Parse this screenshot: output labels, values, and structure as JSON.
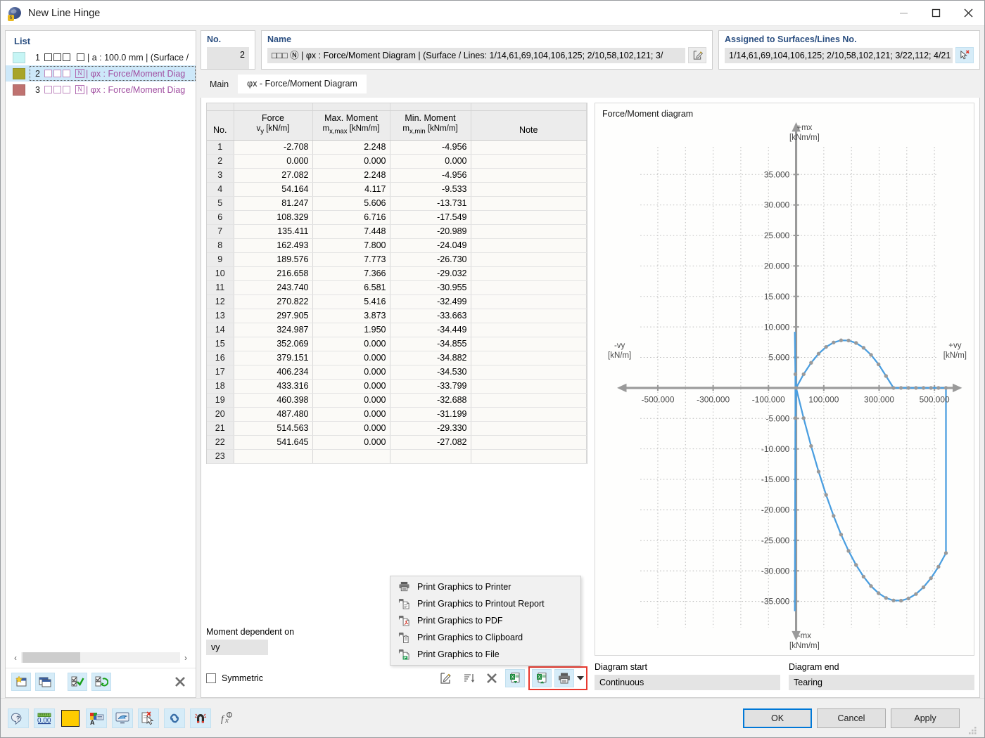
{
  "window": {
    "title": "New Line Hinge",
    "icon": "line-hinge-icon",
    "minimize": "minimize-icon",
    "maximize": "maximize-icon",
    "close": "close-icon"
  },
  "list": {
    "header": "List",
    "items": [
      {
        "num": "1",
        "color": "#c6f5f5",
        "badge": "",
        "text": "| a : 100.0 mm | (Surface /",
        "selected": false,
        "purple": false
      },
      {
        "num": "2",
        "color": "#a8a428",
        "badge": "N",
        "text": "| φx : Force/Moment Diag",
        "selected": true,
        "purple": true
      },
      {
        "num": "3",
        "color": "#bf7270",
        "badge": "N",
        "text": "| φx : Force/Moment Diag",
        "selected": false,
        "purple": true
      }
    ],
    "toolbar": [
      {
        "name": "new-item-button",
        "glyph": "new-window-icon"
      },
      {
        "name": "copy-item-button",
        "glyph": "copy-window-icon"
      },
      {
        "name": "select-all-button",
        "glyph": "check-all-icon"
      },
      {
        "name": "invert-selection-button",
        "glyph": "invert-check-icon"
      },
      {
        "name": "delete-item-button",
        "glyph": "x-icon"
      }
    ]
  },
  "fields": {
    "no_label": "No.",
    "no_value": "2",
    "name_label": "Name",
    "name_value": "□□□  Ⓝ | φx : Force/Moment Diagram | (Surface / Lines: 1/14,61,69,104,106,125; 2/10,58,102,121; 3/",
    "name_edit_button": "edit-name-button",
    "assigned_label": "Assigned to Surfaces/Lines No.",
    "assigned_value": "1/14,61,69,104,106,125; 2/10,58,102,121; 3/22,112; 4/21",
    "assigned_pick_button": "pick-objects-button"
  },
  "tabs": [
    {
      "label": "Main",
      "name": "tab-main",
      "active": false
    },
    {
      "label": "φx - Force/Moment Diagram",
      "name": "tab-force-moment-diagram",
      "active": true
    }
  ],
  "table": {
    "columns": [
      {
        "line1": "",
        "line2": "No."
      },
      {
        "line1": "Force",
        "line2": "vy [kN/m]"
      },
      {
        "line1": "Max. Moment",
        "line2": "mx,max [kNm/m]"
      },
      {
        "line1": "Min. Moment",
        "line2": "mx,min [kNm/m]"
      },
      {
        "line1": "",
        "line2": "Note"
      }
    ],
    "rows": [
      {
        "no": "1",
        "force": "-2.708",
        "mmax": "2.248",
        "mmin": "-4.956",
        "note": ""
      },
      {
        "no": "2",
        "force": "0.000",
        "mmax": "0.000",
        "mmin": "0.000",
        "note": ""
      },
      {
        "no": "3",
        "force": "27.082",
        "mmax": "2.248",
        "mmin": "-4.956",
        "note": ""
      },
      {
        "no": "4",
        "force": "54.164",
        "mmax": "4.117",
        "mmin": "-9.533",
        "note": ""
      },
      {
        "no": "5",
        "force": "81.247",
        "mmax": "5.606",
        "mmin": "-13.731",
        "note": ""
      },
      {
        "no": "6",
        "force": "108.329",
        "mmax": "6.716",
        "mmin": "-17.549",
        "note": ""
      },
      {
        "no": "7",
        "force": "135.411",
        "mmax": "7.448",
        "mmin": "-20.989",
        "note": ""
      },
      {
        "no": "8",
        "force": "162.493",
        "mmax": "7.800",
        "mmin": "-24.049",
        "note": ""
      },
      {
        "no": "9",
        "force": "189.576",
        "mmax": "7.773",
        "mmin": "-26.730",
        "note": ""
      },
      {
        "no": "10",
        "force": "216.658",
        "mmax": "7.366",
        "mmin": "-29.032",
        "note": ""
      },
      {
        "no": "11",
        "force": "243.740",
        "mmax": "6.581",
        "mmin": "-30.955",
        "note": ""
      },
      {
        "no": "12",
        "force": "270.822",
        "mmax": "5.416",
        "mmin": "-32.499",
        "note": ""
      },
      {
        "no": "13",
        "force": "297.905",
        "mmax": "3.873",
        "mmin": "-33.663",
        "note": ""
      },
      {
        "no": "14",
        "force": "324.987",
        "mmax": "1.950",
        "mmin": "-34.449",
        "note": ""
      },
      {
        "no": "15",
        "force": "352.069",
        "mmax": "0.000",
        "mmin": "-34.855",
        "note": ""
      },
      {
        "no": "16",
        "force": "379.151",
        "mmax": "0.000",
        "mmin": "-34.882",
        "note": ""
      },
      {
        "no": "17",
        "force": "406.234",
        "mmax": "0.000",
        "mmin": "-34.530",
        "note": ""
      },
      {
        "no": "18",
        "force": "433.316",
        "mmax": "0.000",
        "mmin": "-33.799",
        "note": ""
      },
      {
        "no": "19",
        "force": "460.398",
        "mmax": "0.000",
        "mmin": "-32.688",
        "note": ""
      },
      {
        "no": "20",
        "force": "487.480",
        "mmax": "0.000",
        "mmin": "-31.199",
        "note": ""
      },
      {
        "no": "21",
        "force": "514.563",
        "mmax": "0.000",
        "mmin": "-29.330",
        "note": ""
      },
      {
        "no": "22",
        "force": "541.645",
        "mmax": "0.000",
        "mmin": "-27.082",
        "note": ""
      },
      {
        "no": "23",
        "force": "",
        "mmax": "",
        "mmin": "",
        "note": ""
      }
    ]
  },
  "moment_dependent": {
    "label": "Moment dependent on",
    "value": "vy",
    "symmetric_label": "Symmetric",
    "symmetric_checked": false
  },
  "table_toolbar": [
    {
      "name": "edit-table-button",
      "glyph": "edit-icon"
    },
    {
      "name": "sort-table-button",
      "glyph": "sort-icon"
    },
    {
      "name": "clear-table-button",
      "glyph": "x-icon"
    },
    {
      "name": "import-excel-button",
      "glyph": "excel-import-icon"
    },
    {
      "name": "export-excel-button",
      "glyph": "excel-export-icon"
    },
    {
      "name": "print-graphics-button",
      "glyph": "printer-icon"
    },
    {
      "name": "print-dropdown-arrow",
      "glyph": "chevron-down-icon"
    }
  ],
  "context_menu": {
    "items": [
      {
        "label": "Print Graphics to Printer",
        "icon": "printer-icon"
      },
      {
        "label": "Print Graphics to Printout Report",
        "icon": "print-report-icon"
      },
      {
        "label": "Print Graphics to PDF",
        "icon": "print-pdf-icon"
      },
      {
        "label": "Print Graphics to Clipboard",
        "icon": "print-clipboard-icon"
      },
      {
        "label": "Print Graphics to File",
        "icon": "print-file-icon"
      }
    ]
  },
  "diagram": {
    "start_label": "Diagram start",
    "start_value": "Continuous",
    "end_label": "Diagram end",
    "end_value": "Tearing"
  },
  "chart_data": {
    "type": "line",
    "title": "Force/Moment diagram",
    "xlabel_pos": "+vy",
    "xlabel_pos_unit": "[kN/m]",
    "xlabel_neg": "-vy",
    "xlabel_neg_unit": "[kN/m]",
    "ylabel_pos": "+mx",
    "ylabel_pos_unit": "[kNm/m]",
    "ylabel_neg": "-mx",
    "ylabel_neg_unit": "[kNm/m]",
    "xticks": [
      "-500.000",
      "-300.000",
      "-100.000",
      "100.000",
      "300.000",
      "500.000"
    ],
    "xtick_values": [
      -500,
      -300,
      -100,
      100,
      300,
      500
    ],
    "yticks": [
      "35.000",
      "30.000",
      "25.000",
      "20.000",
      "15.000",
      "10.000",
      "5.000",
      "-5.000",
      "-10.000",
      "-15.000",
      "-20.000",
      "-25.000",
      "-30.000",
      "-35.000"
    ],
    "ytick_values": [
      35,
      30,
      25,
      20,
      15,
      10,
      5,
      -5,
      -10,
      -15,
      -20,
      -25,
      -30,
      -35
    ],
    "xlim": [
      -620,
      620
    ],
    "ylim": [
      -38,
      38
    ],
    "grid": true,
    "line_color": "#4a9ee0",
    "marker_color": "#9a9a9a",
    "series": [
      {
        "name": "mx,max",
        "x": [
          -2.708,
          0.0,
          27.082,
          54.164,
          81.247,
          108.329,
          135.411,
          162.493,
          189.576,
          216.658,
          243.74,
          270.822,
          297.905,
          324.987,
          352.069,
          379.151,
          406.234,
          433.316,
          460.398,
          487.48,
          514.563,
          541.645
        ],
        "y": [
          2.248,
          0.0,
          2.248,
          4.117,
          5.606,
          6.716,
          7.448,
          7.8,
          7.773,
          7.366,
          6.581,
          5.416,
          3.873,
          1.95,
          0.0,
          0.0,
          0.0,
          0.0,
          0.0,
          0.0,
          0.0,
          0.0
        ]
      },
      {
        "name": "mx,min",
        "x": [
          -2.708,
          0.0,
          27.082,
          54.164,
          81.247,
          108.329,
          135.411,
          162.493,
          189.576,
          216.658,
          243.74,
          270.822,
          297.905,
          324.987,
          352.069,
          379.151,
          406.234,
          433.316,
          460.398,
          487.48,
          514.563,
          541.645
        ],
        "y": [
          -4.956,
          0.0,
          -4.956,
          -9.533,
          -13.731,
          -17.549,
          -20.989,
          -24.049,
          -26.73,
          -29.032,
          -30.955,
          -32.499,
          -33.663,
          -34.449,
          -34.855,
          -34.882,
          -34.53,
          -33.799,
          -32.688,
          -31.199,
          -29.33,
          -27.082
        ]
      }
    ]
  },
  "footer": {
    "tools": [
      {
        "name": "help-button",
        "glyph": "help-icon"
      },
      {
        "name": "units-button",
        "glyph": "units-icon"
      },
      {
        "name": "color-button",
        "glyph": "color-swatch-icon",
        "color": "#ffcc00"
      },
      {
        "name": "display-properties-button",
        "glyph": "display-props-icon"
      },
      {
        "name": "view-mode-button",
        "glyph": "view-mode-icon"
      },
      {
        "name": "select-objects-button",
        "glyph": "select-objects-icon"
      },
      {
        "name": "link-button",
        "glyph": "link-icon"
      },
      {
        "name": "magnet-button",
        "glyph": "magnet-icon"
      },
      {
        "name": "formula-button",
        "glyph": "fx-icon"
      }
    ],
    "ok": "OK",
    "cancel": "Cancel",
    "apply": "Apply"
  }
}
